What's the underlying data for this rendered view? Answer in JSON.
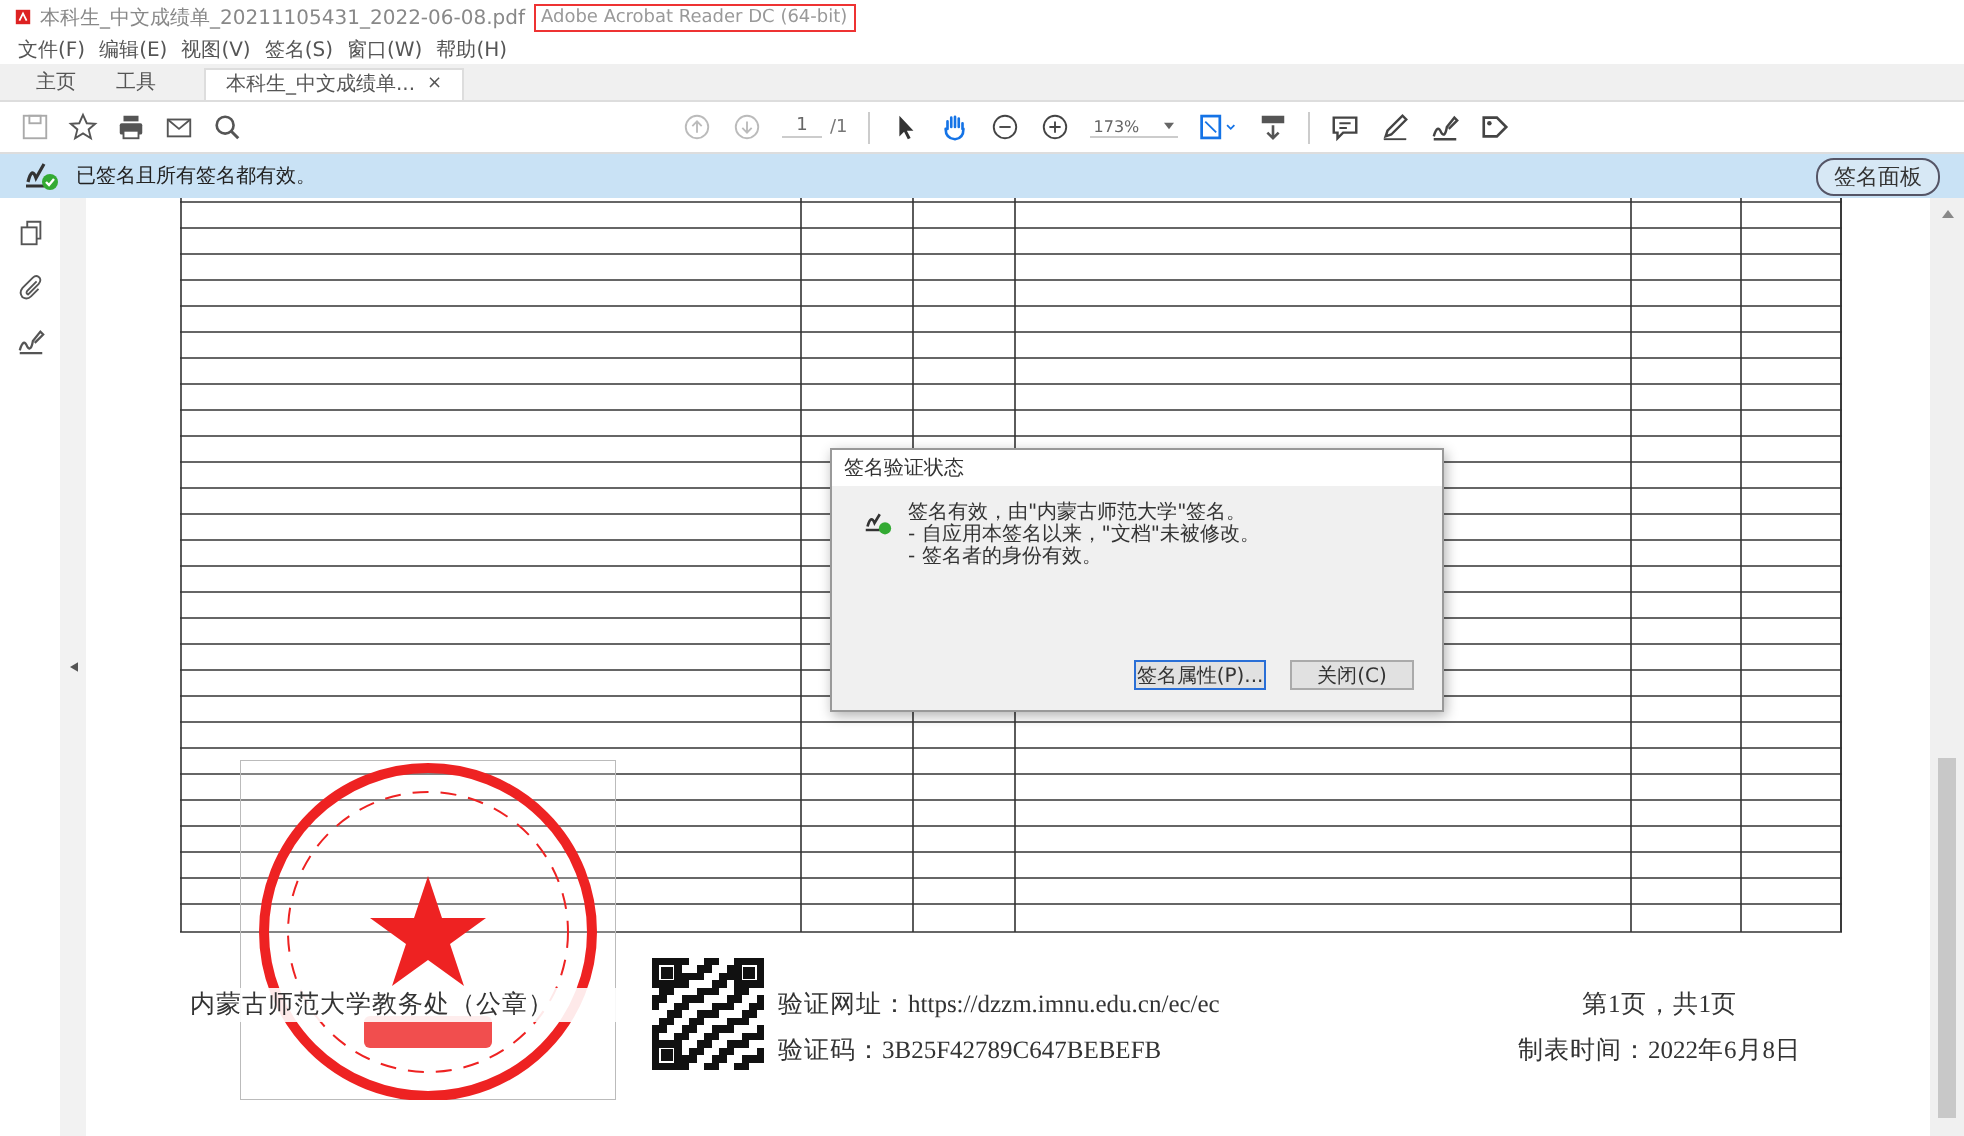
{
  "window": {
    "title": "本科生_中文成绩单_20211105431_2022-06-08.pdf",
    "app_name": "Adobe Acrobat Reader DC (64-bit)"
  },
  "menu": [
    "文件(F)",
    "编辑(E)",
    "视图(V)",
    "签名(S)",
    "窗口(W)",
    "帮助(H)"
  ],
  "tabs": [
    {
      "label": "主页",
      "kind": "plain",
      "selected": false
    },
    {
      "label": "工具",
      "kind": "plain",
      "selected": false
    },
    {
      "label": "本科生_中文成绩单...",
      "kind": "document",
      "close": "×",
      "selected": true
    }
  ],
  "toolbar": {
    "left_tools": [
      {
        "kind": "save"
      },
      {
        "kind": "bookmark"
      },
      {
        "kind": "print"
      },
      {
        "kind": "mail"
      },
      {
        "kind": "search"
      }
    ],
    "page_number": "1",
    "page_total": "/1",
    "zoom": "173%",
    "tools": [
      {
        "kind": "select",
        "selected": false
      },
      {
        "kind": "hand",
        "selected": true
      },
      {
        "kind": "zoom-out",
        "selected": false
      },
      {
        "kind": "zoom-in",
        "selected": false
      }
    ],
    "right_tools": [
      {
        "kind": "fit"
      },
      {
        "kind": "scroll"
      },
      {
        "kind": "comment"
      },
      {
        "kind": "pen"
      },
      {
        "kind": "sign"
      },
      {
        "kind": "tag"
      }
    ]
  },
  "signature_bar": {
    "message": "已签名且所有签名都有效。",
    "button": "签名面板"
  },
  "side_panel": [
    {
      "kind": "pages"
    },
    {
      "kind": "attachment"
    },
    {
      "kind": "sign"
    }
  ],
  "document": {
    "footer": {
      "seal_text": "内蒙古师范大学教务处（公章）",
      "url_line": "验证网址：https://dzzm.imnu.edu.cn/ec/ec",
      "code_line": "验证码：3B25F42789C647BEBEFB",
      "page_info": "第1页，共1页",
      "date_line": "制表时间：2022年6月8日"
    }
  },
  "dialog": {
    "title": "签名验证状态",
    "lines": [
      "签名有效，由\"内蒙古师范大学\"签名。",
      "- 自应用本签名以来，\"文档\"未被修改。",
      "- 签名者的身份有效。"
    ],
    "buttons": [
      {
        "label": "签名属性(P)...",
        "selected": true
      },
      {
        "label": "关闭(C)",
        "selected": false
      }
    ]
  }
}
